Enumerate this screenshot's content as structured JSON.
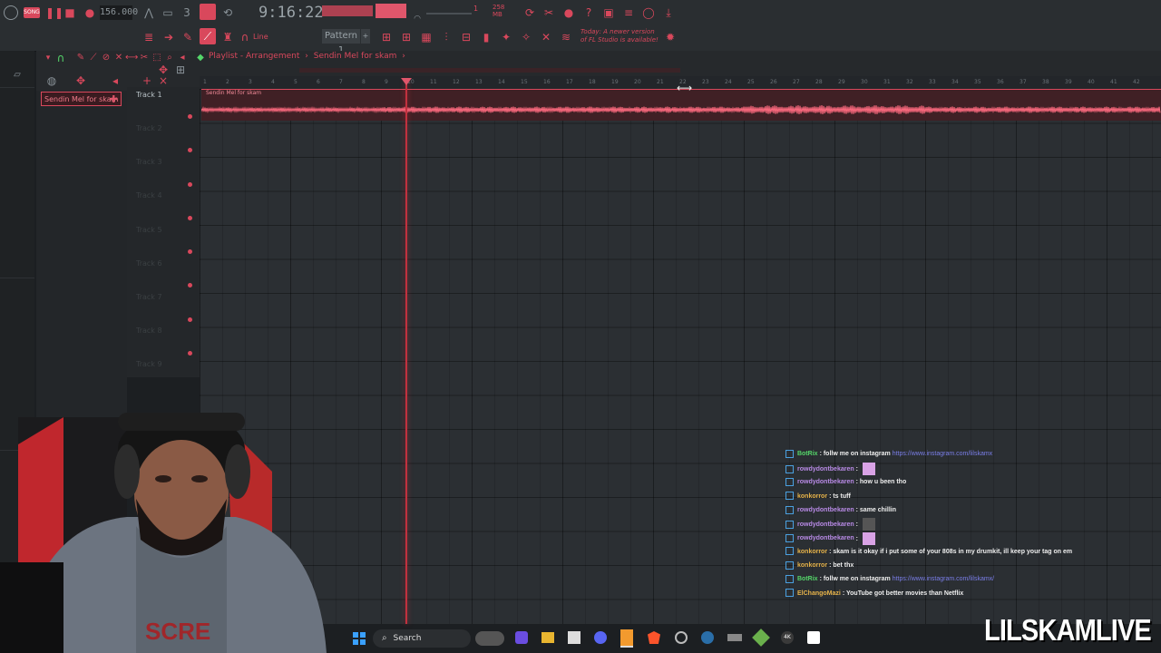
{
  "toolbar": {
    "song_mode": "SONG",
    "tempo": "156.000",
    "time": "9:16:22",
    "ram": "258 MB",
    "ram_sub": "1",
    "pattern": "Pattern 1",
    "snap": "Line",
    "news": "Today: A newer version of FL Studio is available!"
  },
  "playlist": {
    "breadcrumb": [
      "Playlist - Arrangement",
      "Sendin Mel for skam"
    ],
    "pattern_item": "Sendin Mel for skam",
    "tracks": [
      "Track 1",
      "Track 2",
      "Track 3",
      "Track 4",
      "Track 5",
      "Track 6",
      "Track 7",
      "Track 8",
      "Track 9"
    ],
    "clip_label": "Sendin Mel for skam",
    "ruler": [
      "1",
      "2",
      "3",
      "4",
      "5",
      "6",
      "7",
      "8",
      "9",
      "10",
      "11",
      "12",
      "13",
      "14",
      "15",
      "16",
      "17",
      "18",
      "19",
      "20",
      "21",
      "22",
      "23",
      "24",
      "25",
      "26",
      "27",
      "28",
      "29",
      "30",
      "31",
      "32",
      "33",
      "34",
      "35",
      "36",
      "37",
      "38",
      "39",
      "40",
      "41",
      "42"
    ]
  },
  "chat": [
    {
      "user": "BotRix",
      "user_color": "#55d66a",
      "text": "follw me on instagram",
      "link": "https://www.instagram.com/lilskamx"
    },
    {
      "user": "rowdydontbekaren",
      "user_color": "#b88ae6",
      "text": "",
      "emote": true
    },
    {
      "user": "rowdydontbekaren",
      "user_color": "#b88ae6",
      "text": "how u been tho"
    },
    {
      "user": "konkorror",
      "user_color": "#e6b34a",
      "text": "ts tuff"
    },
    {
      "user": "rowdydontbekaren",
      "user_color": "#b88ae6",
      "text": "same chillin"
    },
    {
      "user": "rowdydontbekaren",
      "user_color": "#b88ae6",
      "text": "",
      "emote": true
    },
    {
      "user": "rowdydontbekaren",
      "user_color": "#b88ae6",
      "text": "",
      "emote": true
    },
    {
      "user": "konkorror",
      "user_color": "#e6b34a",
      "text": "skam is it okay if i put some of your 808s in my drumkit, ill keep your tag on em"
    },
    {
      "user": "konkorror",
      "user_color": "#e6b34a",
      "text": "bet thx"
    },
    {
      "user": "BotRix",
      "user_color": "#55d66a",
      "text": "follw me on instagram",
      "link": "https://www.instagram.com/lilskamx/"
    },
    {
      "user": "ElChangoMazi",
      "user_color": "#e6b34a",
      "text": "YouTube got better movies than Netflix"
    }
  ],
  "taskbar": {
    "search": "Search"
  },
  "overlay": {
    "brand": "LILSKAMLIVE"
  }
}
